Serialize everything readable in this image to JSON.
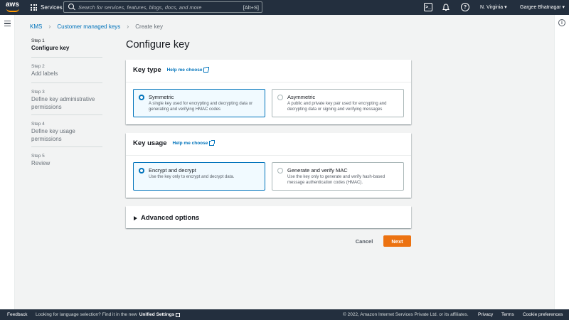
{
  "topnav": {
    "logo_text": "aws",
    "services_label": "Services",
    "search_placeholder": "Search for services, features, blogs, docs, and more",
    "search_shortcut": "[Alt+S]",
    "cloudshell_icon": "cloudshell-icon",
    "bell_icon": "bell-icon",
    "help_icon": "help-icon",
    "region_label": "N. Virginia ▾",
    "user_label": "Gargee Bhatnagar ▾"
  },
  "breadcrumb": {
    "items": [
      "KMS",
      "Customer managed keys",
      "Create key"
    ]
  },
  "steps": [
    {
      "num": "Step 1",
      "name": "Configure key",
      "active": true
    },
    {
      "num": "Step 2",
      "name": "Add labels",
      "active": false
    },
    {
      "num": "Step 3",
      "name": "Define key administrative permissions",
      "active": false
    },
    {
      "num": "Step 4",
      "name": "Define key usage permissions",
      "active": false
    },
    {
      "num": "Step 5",
      "name": "Review",
      "active": false
    }
  ],
  "page_title": "Configure key",
  "key_type": {
    "title": "Key type",
    "help_link": "Help me choose",
    "options": [
      {
        "title": "Symmetric",
        "desc": "A single key used for encrypting and decrypting data or generating and verifying HMAC codes",
        "selected": true
      },
      {
        "title": "Asymmetric",
        "desc": "A public and private key pair used for encrypting and decrypting data or signing and verifying messages",
        "selected": false
      }
    ]
  },
  "key_usage": {
    "title": "Key usage",
    "help_link": "Help me choose",
    "options": [
      {
        "title": "Encrypt and decrypt",
        "desc": "Use the key only to encrypt and decrypt data.",
        "selected": true
      },
      {
        "title": "Generate and verify MAC",
        "desc": "Use the key only to generate and verify hash-based message authentication codes (HMAC).",
        "selected": false
      }
    ]
  },
  "advanced": {
    "title": "Advanced options"
  },
  "actions": {
    "cancel": "Cancel",
    "next": "Next"
  },
  "footer": {
    "feedback": "Feedback",
    "lang_prompt": "Looking for language selection? Find it in the new",
    "lang_link": "Unified Settings",
    "copyright": "© 2022, Amazon Internet Services Private Ltd. or its affiliates.",
    "privacy": "Privacy",
    "terms": "Terms",
    "cookie": "Cookie preferences"
  },
  "colors": {
    "nav_bg": "#232f3e",
    "accent": "#0073bb",
    "primary_button": "#ec7211",
    "logo_smile": "#ff9900"
  }
}
